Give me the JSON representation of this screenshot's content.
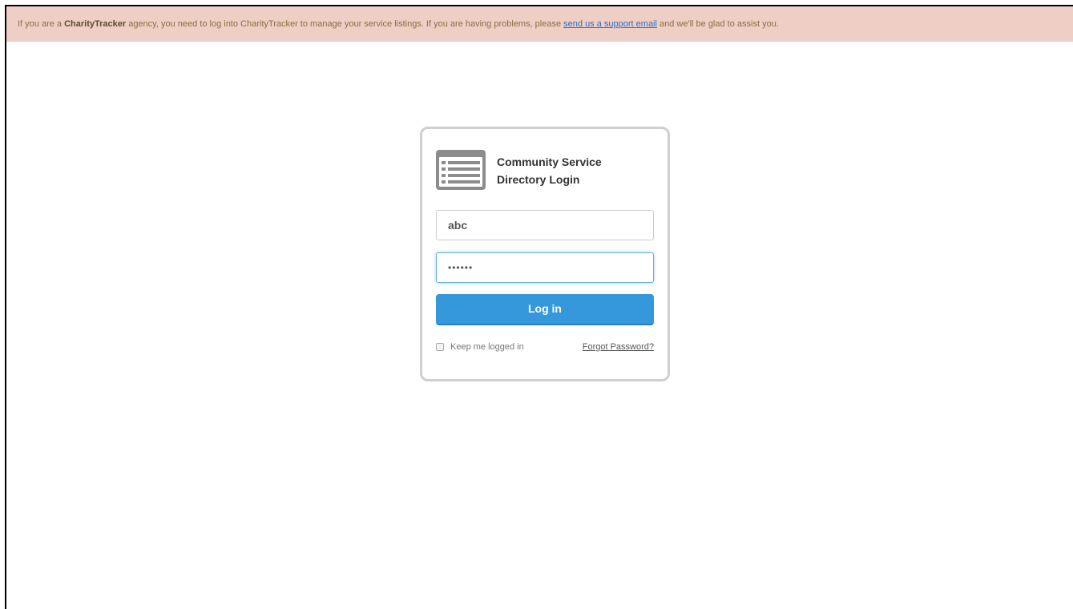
{
  "notice": {
    "prefix": "If you are a ",
    "brand": "CharityTracker",
    "middle": " agency, you need to log into CharityTracker to manage your service listings. If you are having problems, please ",
    "link_text": "send us a support email",
    "suffix": " and we'll be glad to assist you.",
    "background_color": "#efcfc5"
  },
  "login": {
    "logo_icon": "directory-list-icon",
    "title_line1": "Community Service",
    "title_line2": "Directory Login",
    "username_value": "abc",
    "password_value": "••••••",
    "login_button": "Log in",
    "keep_logged_in_label": "Keep me logged in",
    "keep_logged_in_checked": false,
    "forgot_password_link": "Forgot Password?",
    "accent_color": "#3498db"
  }
}
